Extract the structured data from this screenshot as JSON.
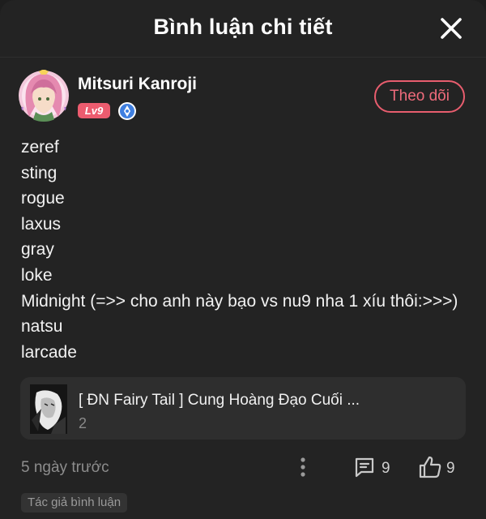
{
  "header": {
    "title": "Bình luận chi tiết",
    "close_icon": "close-icon"
  },
  "comment": {
    "author": {
      "name": "Mitsuri Kanroji",
      "level_badge": "Lv9",
      "avatar_icon": "anime-avatar",
      "verify_icon": "verified-icon"
    },
    "follow_label": "Theo dõi",
    "lines": [
      "zeref",
      "sting",
      "rogue",
      "laxus",
      "gray",
      "loke",
      "Midnight (=>> cho anh này bạo vs nu9 nha 1 xíu thôi:>>>)",
      "natsu",
      "larcade"
    ],
    "story": {
      "title": "[ ĐN Fairy Tail ] Cung Hoàng Đạo Cuối ...",
      "count": "2"
    },
    "timestamp": "5 ngày trước",
    "reply_count": "9",
    "like_count": "9",
    "author_tag": "Tác giả bình luận"
  },
  "colors": {
    "background": "#232323",
    "accent": "#e85d6e",
    "badge": "#ec5c6f",
    "verify": "#3f7fe0"
  }
}
